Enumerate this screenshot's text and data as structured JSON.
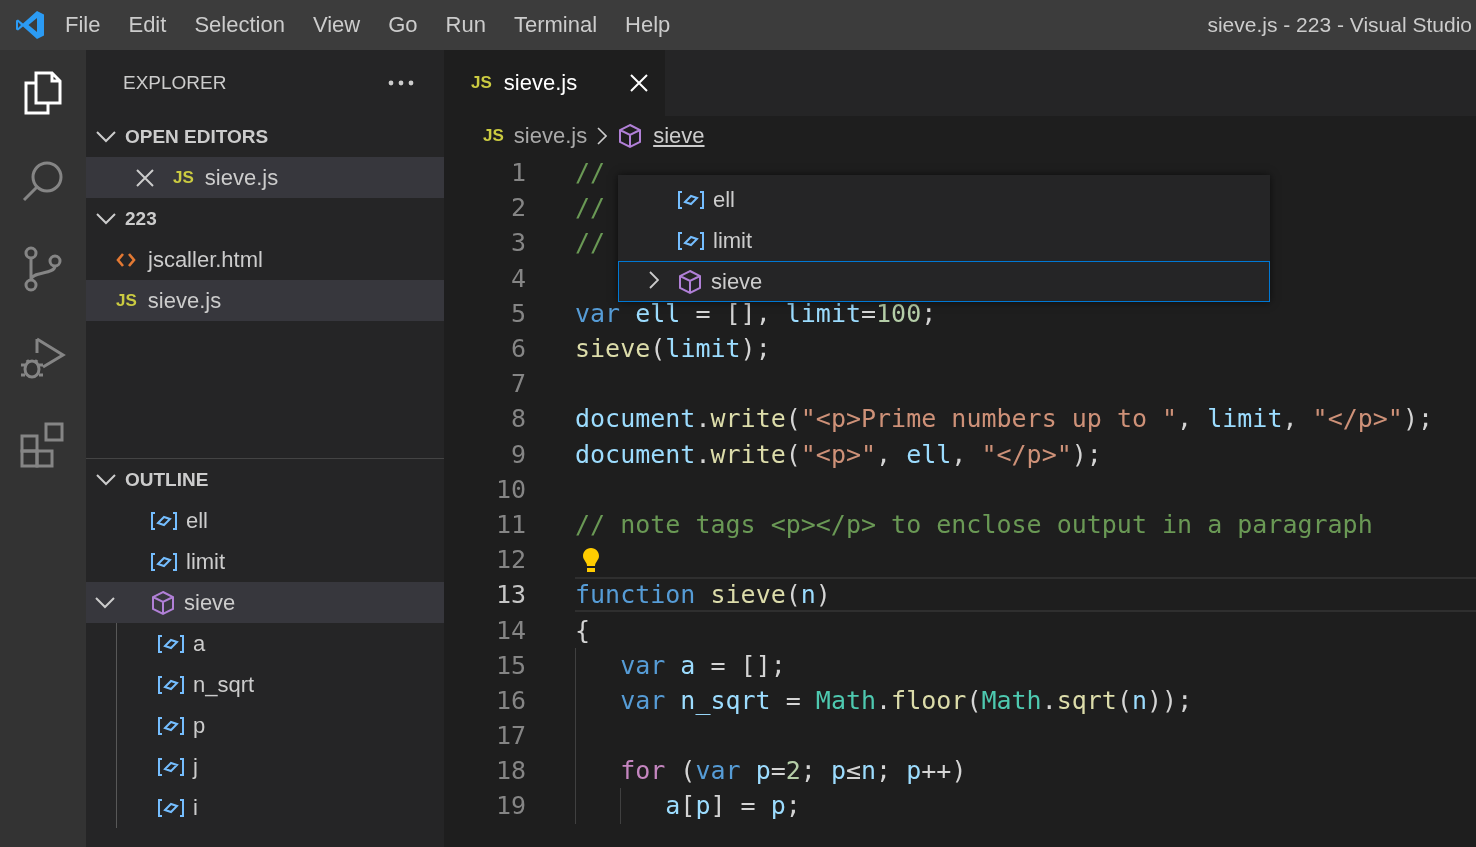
{
  "title_bar": {
    "menu": [
      "File",
      "Edit",
      "Selection",
      "View",
      "Go",
      "Run",
      "Terminal",
      "Help"
    ],
    "title": "sieve.js - 223 - Visual Studio"
  },
  "activity_bar": [
    {
      "kind": "explorer",
      "selected": true
    },
    {
      "kind": "search",
      "selected": false
    },
    {
      "kind": "source-control",
      "selected": false
    },
    {
      "kind": "run",
      "selected": false
    },
    {
      "kind": "extensions",
      "selected": false
    }
  ],
  "sidebar": {
    "title": "EXPLORER",
    "sections": [
      {
        "title": "OPEN EDITORS",
        "expanded": true,
        "items": [
          {
            "kind": "js",
            "icon_label": "JS",
            "name": "sieve.js",
            "selected": true,
            "closable": true
          }
        ]
      },
      {
        "title": "223",
        "expanded": true,
        "items": [
          {
            "kind": "html",
            "name": "jscaller.html",
            "selected": false,
            "closable": false
          },
          {
            "kind": "js",
            "icon_label": "JS",
            "name": "sieve.js",
            "selected": true,
            "closable": false
          }
        ]
      }
    ],
    "outline": {
      "title": "OUTLINE",
      "expanded": true,
      "items": [
        {
          "kind": "variable",
          "name": "ell",
          "selected": false
        },
        {
          "kind": "variable",
          "name": "limit",
          "selected": false
        },
        {
          "kind": "function",
          "name": "sieve",
          "selected": true,
          "expanded": true,
          "children": [
            {
              "kind": "variable",
              "name": "a",
              "selected": false
            },
            {
              "kind": "variable",
              "name": "n_sqrt",
              "selected": false
            },
            {
              "kind": "variable",
              "name": "p",
              "selected": false
            },
            {
              "kind": "variable",
              "name": "j",
              "selected": false
            },
            {
              "kind": "variable",
              "name": "i",
              "selected": false
            }
          ]
        }
      ]
    }
  },
  "editor": {
    "tabs": [
      {
        "icon_label": "JS",
        "label": "sieve.js",
        "selected": true
      }
    ],
    "breadcrumbs": [
      {
        "kind": "js",
        "icon_label": "JS",
        "label": "sieve.js"
      },
      {
        "kind": "function",
        "label": "sieve"
      }
    ],
    "symbol_popup": [
      {
        "kind": "variable",
        "label": "ell",
        "selected": false,
        "expandable": false
      },
      {
        "kind": "variable",
        "label": "limit",
        "selected": false,
        "expandable": false
      },
      {
        "kind": "function",
        "label": "sieve",
        "selected": true,
        "expandable": true
      }
    ],
    "lines": [
      {
        "number": "1",
        "tokens": [
          {
            "kind": "comment",
            "t": "//"
          }
        ]
      },
      {
        "number": "2",
        "tokens": [
          {
            "kind": "comment",
            "t": "//"
          }
        ]
      },
      {
        "number": "3",
        "tokens": [
          {
            "kind": "comment",
            "t": "//"
          }
        ]
      },
      {
        "number": "4"
      },
      {
        "number": "5",
        "tokens": [
          {
            "kind": "keyword",
            "t": "var"
          },
          {
            "kind": "variable",
            "t": " ell"
          },
          {
            "kind": "punctuation",
            "t": " = [], "
          },
          {
            "kind": "variable",
            "t": "limit"
          },
          {
            "kind": "punctuation",
            "t": "="
          },
          {
            "kind": "number",
            "t": "100"
          },
          {
            "kind": "punctuation",
            "t": ";"
          }
        ]
      },
      {
        "number": "6",
        "tokens": [
          {
            "kind": "function",
            "t": "sieve"
          },
          {
            "kind": "punctuation",
            "t": "("
          },
          {
            "kind": "variable",
            "t": "limit"
          },
          {
            "kind": "punctuation",
            "t": ");"
          }
        ]
      },
      {
        "number": "7"
      },
      {
        "number": "8",
        "tokens": [
          {
            "kind": "variable",
            "t": "document"
          },
          {
            "kind": "punctuation",
            "t": "."
          },
          {
            "kind": "function",
            "t": "write"
          },
          {
            "kind": "punctuation",
            "t": "("
          },
          {
            "kind": "string",
            "t": "\"<p>Prime numbers up to \""
          },
          {
            "kind": "punctuation",
            "t": ", "
          },
          {
            "kind": "variable",
            "t": "limit"
          },
          {
            "kind": "punctuation",
            "t": ", "
          },
          {
            "kind": "string",
            "t": "\"</p>\""
          },
          {
            "kind": "punctuation",
            "t": ");"
          }
        ]
      },
      {
        "number": "9",
        "tokens": [
          {
            "kind": "variable",
            "t": "document"
          },
          {
            "kind": "punctuation",
            "t": "."
          },
          {
            "kind": "function",
            "t": "write"
          },
          {
            "kind": "punctuation",
            "t": "("
          },
          {
            "kind": "string",
            "t": "\"<p>\""
          },
          {
            "kind": "punctuation",
            "t": ", "
          },
          {
            "kind": "variable",
            "t": "ell"
          },
          {
            "kind": "punctuation",
            "t": ", "
          },
          {
            "kind": "string",
            "t": "\"</p>\""
          },
          {
            "kind": "punctuation",
            "t": ");"
          }
        ]
      },
      {
        "number": "10"
      },
      {
        "number": "11",
        "tokens": [
          {
            "kind": "comment",
            "t": "// note tags <p></p> to enclose output in a paragraph"
          }
        ]
      },
      {
        "number": "12",
        "lightbulb": true
      },
      {
        "number": "13",
        "tokens": [
          {
            "kind": "keyword",
            "t": "function"
          },
          {
            "kind": "function",
            "t": " sieve"
          },
          {
            "kind": "punctuation",
            "t": "("
          },
          {
            "kind": "variable",
            "t": "n"
          },
          {
            "kind": "punctuation",
            "t": ")"
          }
        ],
        "current": true
      },
      {
        "number": "14",
        "tokens": [
          {
            "kind": "punctuation",
            "t": "{"
          }
        ]
      },
      {
        "number": "15",
        "tokens": [
          {
            "kind": "keyword",
            "t": "   var"
          },
          {
            "kind": "variable",
            "t": " a"
          },
          {
            "kind": "punctuation",
            "t": " = [];"
          }
        ]
      },
      {
        "number": "16",
        "tokens": [
          {
            "kind": "keyword",
            "t": "   var"
          },
          {
            "kind": "variable",
            "t": " n_sqrt"
          },
          {
            "kind": "punctuation",
            "t": " = "
          },
          {
            "kind": "class",
            "t": "Math"
          },
          {
            "kind": "punctuation",
            "t": "."
          },
          {
            "kind": "function",
            "t": "floor"
          },
          {
            "kind": "punctuation",
            "t": "("
          },
          {
            "kind": "class",
            "t": "Math"
          },
          {
            "kind": "punctuation",
            "t": "."
          },
          {
            "kind": "function",
            "t": "sqrt"
          },
          {
            "kind": "punctuation",
            "t": "("
          },
          {
            "kind": "variable",
            "t": "n"
          },
          {
            "kind": "punctuation",
            "t": "));"
          }
        ]
      },
      {
        "number": "17"
      },
      {
        "number": "18",
        "tokens": [
          {
            "kind": "control",
            "t": "   for"
          },
          {
            "kind": "punctuation",
            "t": " ("
          },
          {
            "kind": "keyword",
            "t": "var"
          },
          {
            "kind": "variable",
            "t": " p"
          },
          {
            "kind": "punctuation",
            "t": "="
          },
          {
            "kind": "number",
            "t": "2"
          },
          {
            "kind": "punctuation",
            "t": "; "
          },
          {
            "kind": "variable",
            "t": "p"
          },
          {
            "kind": "punctuation",
            "t": "≤"
          },
          {
            "kind": "variable",
            "t": "n"
          },
          {
            "kind": "punctuation",
            "t": "; "
          },
          {
            "kind": "variable",
            "t": "p"
          },
          {
            "kind": "punctuation",
            "t": "++)"
          }
        ]
      },
      {
        "number": "19",
        "tokens": [
          {
            "kind": "variable",
            "t": "      a"
          },
          {
            "kind": "punctuation",
            "t": "["
          },
          {
            "kind": "variable",
            "t": "p"
          },
          {
            "kind": "punctuation",
            "t": "] = "
          },
          {
            "kind": "variable",
            "t": "p"
          },
          {
            "kind": "punctuation",
            "t": ";"
          }
        ]
      }
    ]
  }
}
